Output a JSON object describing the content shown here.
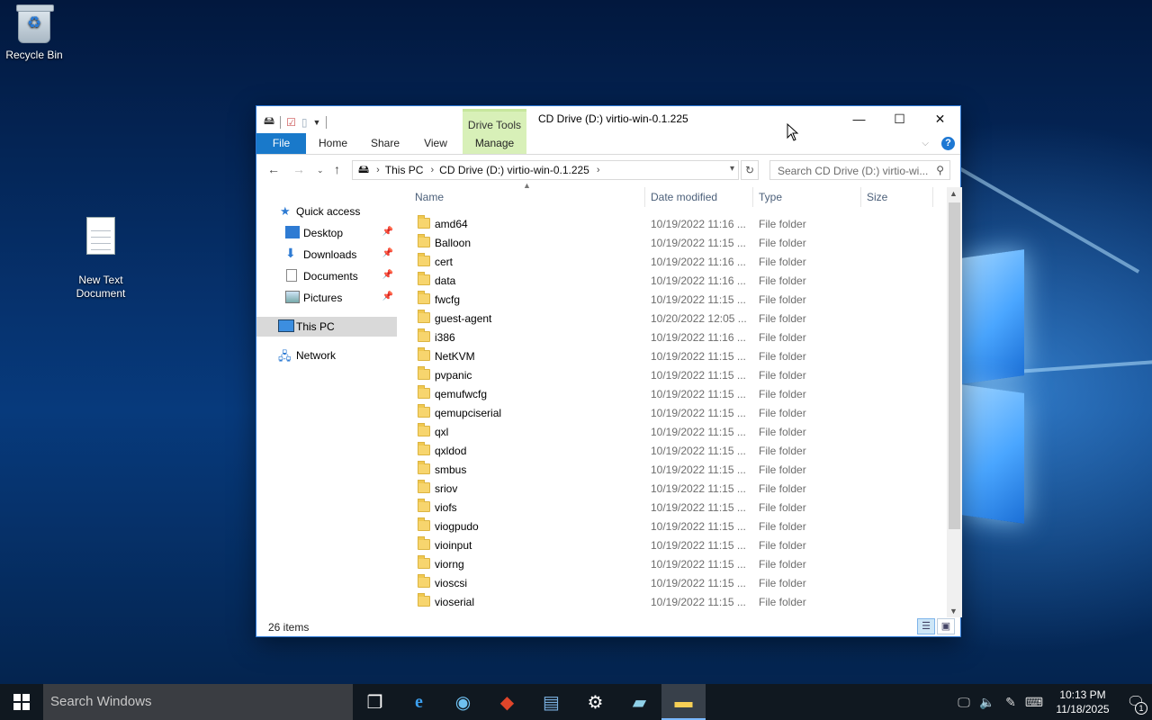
{
  "desktop": {
    "icons": [
      {
        "label": "Recycle Bin"
      },
      {
        "label": "New Text\nDocument"
      }
    ]
  },
  "window": {
    "title": "CD Drive (D:) virtio-win-0.1.225",
    "contextual_tab_group": "Drive Tools",
    "tabs": [
      "File",
      "Home",
      "Share",
      "View",
      "Manage"
    ],
    "address": {
      "segments": [
        "This PC",
        "CD Drive (D:) virtio-win-0.1.225"
      ]
    },
    "search_placeholder": "Search CD Drive (D:) virtio-wi...",
    "nav": {
      "quick_access": "Quick access",
      "items": [
        {
          "label": "Desktop",
          "pinned": true
        },
        {
          "label": "Downloads",
          "pinned": true
        },
        {
          "label": "Documents",
          "pinned": true
        },
        {
          "label": "Pictures",
          "pinned": true
        }
      ],
      "this_pc": "This PC",
      "network": "Network"
    },
    "columns": {
      "name": "Name",
      "date": "Date modified",
      "type": "Type",
      "size": "Size"
    },
    "files": [
      {
        "name": "amd64",
        "date": "10/19/2022 11:16 ...",
        "type": "File folder"
      },
      {
        "name": "Balloon",
        "date": "10/19/2022 11:15 ...",
        "type": "File folder"
      },
      {
        "name": "cert",
        "date": "10/19/2022 11:16 ...",
        "type": "File folder"
      },
      {
        "name": "data",
        "date": "10/19/2022 11:16 ...",
        "type": "File folder"
      },
      {
        "name": "fwcfg",
        "date": "10/19/2022 11:15 ...",
        "type": "File folder"
      },
      {
        "name": "guest-agent",
        "date": "10/20/2022 12:05 ...",
        "type": "File folder"
      },
      {
        "name": "i386",
        "date": "10/19/2022 11:16 ...",
        "type": "File folder"
      },
      {
        "name": "NetKVM",
        "date": "10/19/2022 11:15 ...",
        "type": "File folder"
      },
      {
        "name": "pvpanic",
        "date": "10/19/2022 11:15 ...",
        "type": "File folder"
      },
      {
        "name": "qemufwcfg",
        "date": "10/19/2022 11:15 ...",
        "type": "File folder"
      },
      {
        "name": "qemupciserial",
        "date": "10/19/2022 11:15 ...",
        "type": "File folder"
      },
      {
        "name": "qxl",
        "date": "10/19/2022 11:15 ...",
        "type": "File folder"
      },
      {
        "name": "qxldod",
        "date": "10/19/2022 11:15 ...",
        "type": "File folder"
      },
      {
        "name": "smbus",
        "date": "10/19/2022 11:15 ...",
        "type": "File folder"
      },
      {
        "name": "sriov",
        "date": "10/19/2022 11:15 ...",
        "type": "File folder"
      },
      {
        "name": "viofs",
        "date": "10/19/2022 11:15 ...",
        "type": "File folder"
      },
      {
        "name": "viogpudo",
        "date": "10/19/2022 11:15 ...",
        "type": "File folder"
      },
      {
        "name": "vioinput",
        "date": "10/19/2022 11:15 ...",
        "type": "File folder"
      },
      {
        "name": "viorng",
        "date": "10/19/2022 11:15 ...",
        "type": "File folder"
      },
      {
        "name": "vioscsi",
        "date": "10/19/2022 11:15 ...",
        "type": "File folder"
      },
      {
        "name": "vioserial",
        "date": "10/19/2022 11:15 ...",
        "type": "File folder"
      }
    ],
    "status": "26 items"
  },
  "taskbar": {
    "search_placeholder": "Search Windows",
    "time": "10:13 PM",
    "date": "11/18/2025",
    "notification_count": "1",
    "accent_color": "#7ab8ff"
  },
  "colors": {
    "file_tab": "#1979ca",
    "drive_tools": "#d8f0b8",
    "window_border": "#2b78d6",
    "selection": "#d9d9d9"
  }
}
